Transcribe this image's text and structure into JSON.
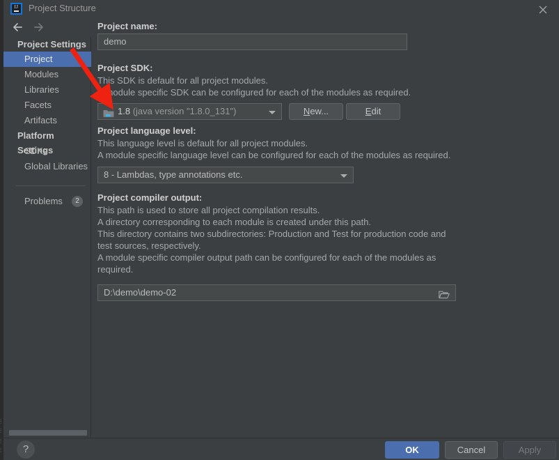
{
  "window": {
    "title": "Project Structure",
    "logo_icon": "intellij-idea-logo",
    "close_icon": "close-icon"
  },
  "toolbar": {
    "back_icon": "arrow-left-icon",
    "forward_icon": "arrow-right-icon"
  },
  "sidebar": {
    "groups": [
      {
        "header": "Project Settings",
        "items": [
          {
            "label": "Project",
            "selected": true
          },
          {
            "label": "Modules",
            "selected": false
          },
          {
            "label": "Libraries",
            "selected": false
          },
          {
            "label": "Facets",
            "selected": false
          },
          {
            "label": "Artifacts",
            "selected": false
          }
        ]
      },
      {
        "header": "Platform Settings",
        "items": [
          {
            "label": "SDKs",
            "selected": false
          },
          {
            "label": "Global Libraries",
            "selected": false
          }
        ]
      }
    ],
    "problems": {
      "label": "Problems",
      "badge": "2"
    }
  },
  "main": {
    "project_name": {
      "title": "Project name:",
      "value": "demo"
    },
    "project_sdk": {
      "title": "Project SDK:",
      "desc_line1": "This SDK is default for all project modules.",
      "desc_line2": "A module specific SDK can be configured for each of the modules as required.",
      "selected_version": "1.8",
      "selected_detail": "(java version \"1.8.0_131\")",
      "sdk_icon": "java-sdk-folder-icon",
      "caret_icon": "chevron-down-icon",
      "new_button": "New...",
      "new_button_mnemonic": "N",
      "edit_button": "Edit",
      "edit_button_mnemonic": "E"
    },
    "language_level": {
      "title": "Project language level:",
      "desc_line1": "This language level is default for all project modules.",
      "desc_line2": "A module specific language level can be configured for each of the modules as required.",
      "selected": "8 - Lambdas, type annotations etc.",
      "caret_icon": "chevron-down-icon"
    },
    "compiler_output": {
      "title": "Project compiler output:",
      "desc_line1": "This path is used to store all project compilation results.",
      "desc_line2": "A directory corresponding to each module is created under this path.",
      "desc_line3": "This directory contains two subdirectories: Production and Test for production code and",
      "desc_line4": "test sources, respectively.",
      "desc_line5": "A module specific compiler output path can be configured for each of the modules as",
      "desc_line6": "required.",
      "path_value": "D:\\demo\\demo-02",
      "browse_icon": "folder-browse-icon"
    }
  },
  "footer": {
    "help_label": "?",
    "ok_label": "OK",
    "cancel_label": "Cancel",
    "apply_label": "Apply"
  },
  "annotation": {
    "arrow_icon": "red-pointer-arrow",
    "arrow_color": "#ee2211"
  },
  "colors": {
    "background": "#3c3f41",
    "selection": "#4b6eaf",
    "field_background": "#45494a",
    "accent_ok": "#4b6eaf",
    "text_primary": "#bbbbbb"
  }
}
